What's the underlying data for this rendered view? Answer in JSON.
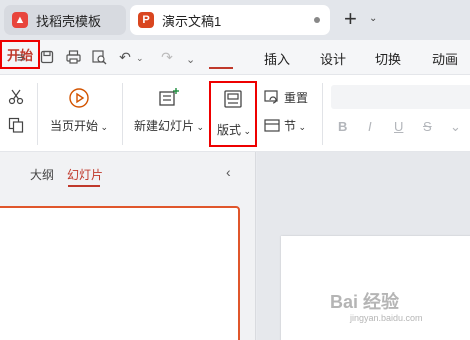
{
  "tabs": {
    "templates": {
      "label": "找稻壳模板",
      "icon": "wps-flame-icon"
    },
    "document": {
      "label": "演示文稿1",
      "icon": "presentation-p-icon",
      "icon_letter": "P"
    },
    "new_tab_symbol": "+"
  },
  "menu": {
    "items": [
      "开始",
      "插入",
      "设计",
      "切换",
      "动画"
    ]
  },
  "ribbon": {
    "play_from_current": "当页开始",
    "new_slide": "新建幻灯片",
    "layout": "版式",
    "reset": "重置",
    "section": "节",
    "format_buttons": [
      "B",
      "I",
      "U",
      "S"
    ]
  },
  "panel": {
    "outline_tab": "大纲",
    "slides_tab": "幻灯片"
  },
  "watermark": {
    "brand": "Bai 经验",
    "url": "jingyan.baidu.com"
  },
  "colors": {
    "accent": "#c0392b",
    "highlight_box": "#ee0000"
  }
}
